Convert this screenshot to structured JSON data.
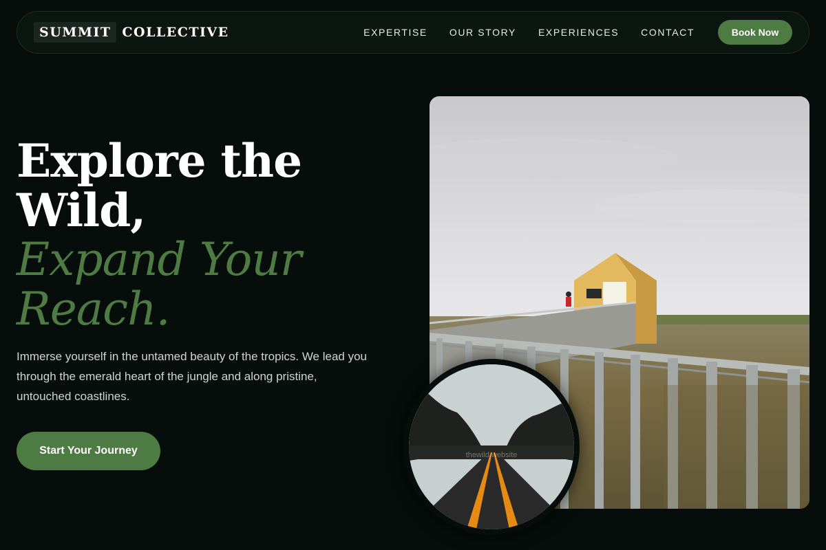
{
  "brand": {
    "box_text": "SUMMIT",
    "rest_text": "COLLECTIVE"
  },
  "nav": {
    "links": [
      "EXPERTISE",
      "OUR STORY",
      "EXPERIENCES",
      "CONTACT"
    ],
    "book_label": "Book Now"
  },
  "hero": {
    "line1": "Explore the",
    "line2": "Wild,",
    "accent1": "Expand Your",
    "accent2": "Reach.",
    "subtitle": "Immerse yourself in the untamed beauty of the tropics. We lead you through the emerald heart of the jungle and along pristine, untouched coastlines.",
    "cta_label": "Start Your Journey"
  },
  "images": {
    "round_watermark": "thewild.website"
  },
  "colors": {
    "background": "#070d0a",
    "accent": "#4e7a43",
    "nav_bg": "#0b1610"
  }
}
